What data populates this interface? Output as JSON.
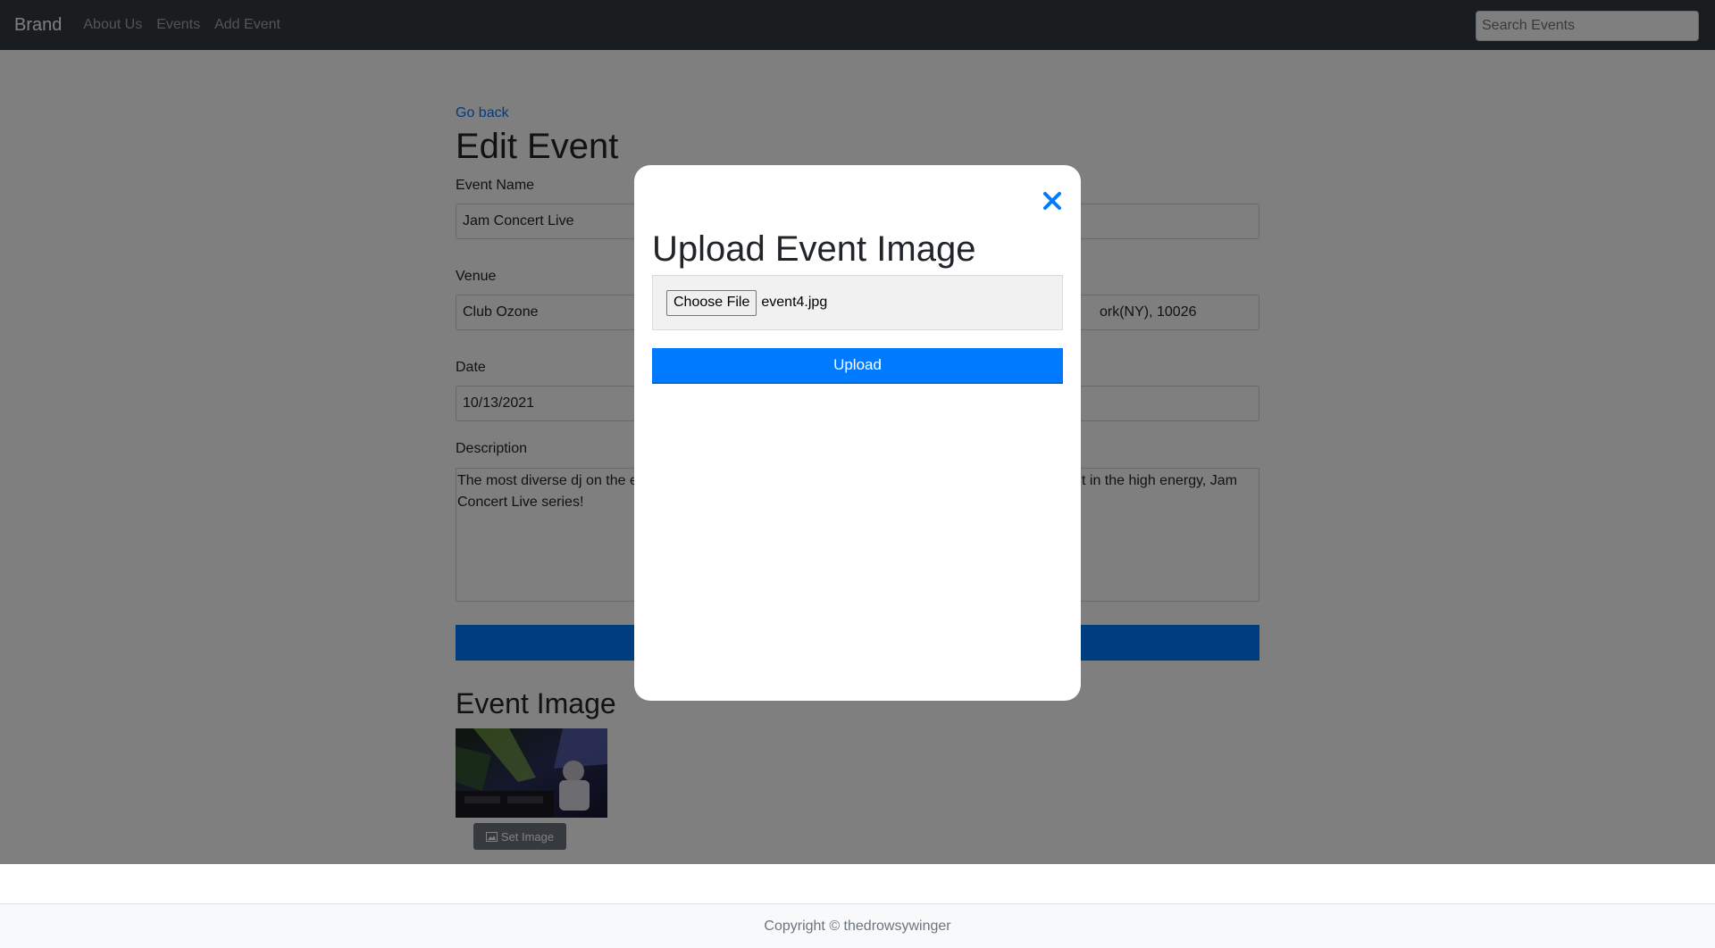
{
  "navbar": {
    "brand": "Brand",
    "links": [
      "About Us",
      "Events",
      "Add Event"
    ],
    "search_placeholder": "Search Events"
  },
  "page": {
    "go_back": "Go back",
    "title": "Edit Event",
    "event_name_label": "Event Name",
    "event_name_value": "Jam Concert Live",
    "venue_label": "Venue",
    "venue_value": "Club Ozone",
    "address_visible_fragment": "ork(NY), 10026",
    "date_label": "Date",
    "date_value": "10/13/2021",
    "description_label": "Description",
    "description_line1_left": "The most diverse dj on the e",
    "description_line1_right": "t in the high energy, Jam",
    "description_line2": "Concert Live series!",
    "event_image_title": "Event Image",
    "set_image_button": "Set Image"
  },
  "modal": {
    "title": "Upload Event Image",
    "choose_file_label": "Choose File",
    "file_name": "event4.jpg",
    "upload_button": "Upload"
  },
  "footer": {
    "copyright": "Copyright © thedrowsywinger"
  },
  "colors": {
    "primary": "#007bff",
    "navbar": "#343a40",
    "overlay": "rgba(0,0,0,0.5)"
  }
}
